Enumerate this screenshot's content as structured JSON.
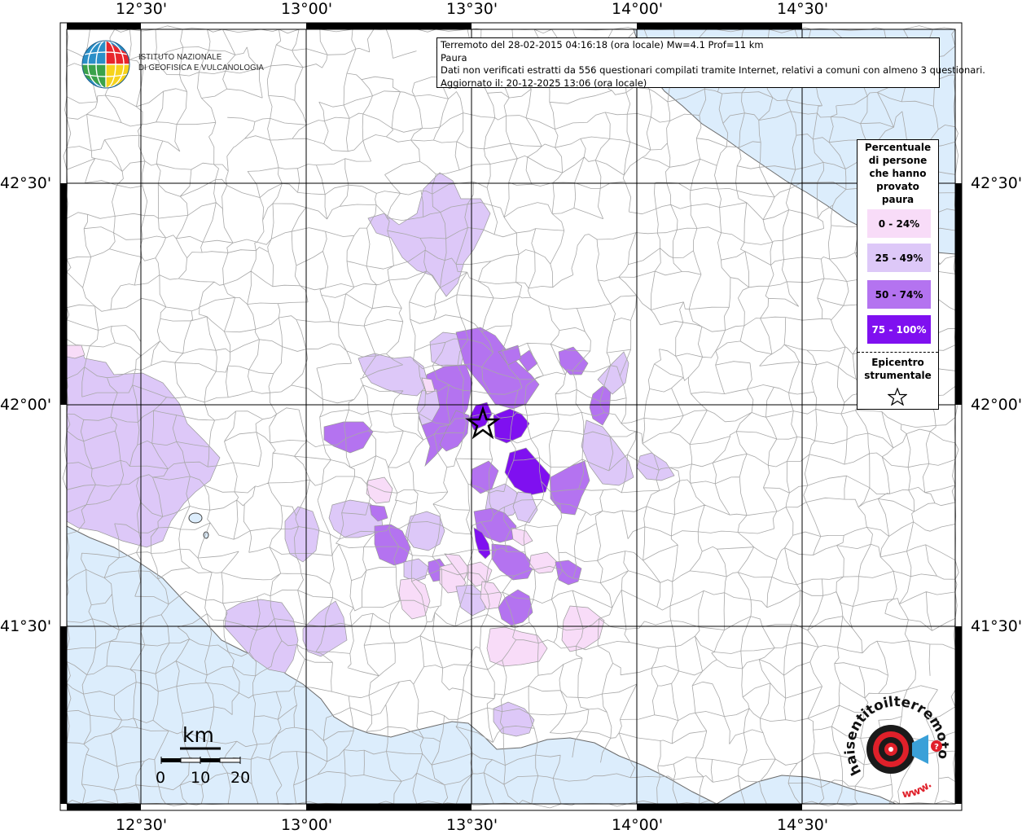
{
  "info": {
    "line1": "Terremoto del 28-02-2015 04:16:18 (ora locale) Mw=4.1 Prof=11 km",
    "line2": "Paura",
    "line3": "Dati non verificati estratti da 556 questionari compilati tramite Internet, relativi a comuni con almeno 3 questionari.",
    "line4": "Aggiornato il: 20-12-2025 13:06 (ora locale)"
  },
  "institute": {
    "line1": "ISTITUTO NAZIONALE",
    "line2": "DI GEOFISICA E VULCANOLOGIA"
  },
  "legend": {
    "title_lines": [
      "Percentuale",
      "di persone",
      "che hanno",
      "provato",
      "paura"
    ],
    "classes": [
      {
        "label": "0 - 24%",
        "color": "#f8dcf8",
        "text_color": "#000000"
      },
      {
        "label": "25 - 49%",
        "color": "#ddc8f8",
        "text_color": "#000000"
      },
      {
        "label": "50 - 74%",
        "color": "#b473f0",
        "text_color": "#000000"
      },
      {
        "label": "75 - 100%",
        "color": "#7f10f0",
        "text_color": "#ffffff"
      }
    ],
    "epicenter_lines": [
      "Epicentro",
      "strumentale"
    ]
  },
  "graticule": {
    "lon_labels": [
      "12°30'",
      "13°00'",
      "13°30'",
      "14°00'",
      "14°30'"
    ],
    "lat_labels": [
      "42°30'",
      "42°00'",
      "41°30'"
    ]
  },
  "scale": {
    "unit": "km",
    "ticks": [
      "0",
      "10",
      "20"
    ]
  },
  "colors": {
    "sea": "#dcedfc",
    "land": "#ffffff",
    "border": "#a8a8a8",
    "grid": "#000000"
  },
  "hst_logo_text": "haisentitoilterremoto.it",
  "hst_logo_url_text": "www."
}
